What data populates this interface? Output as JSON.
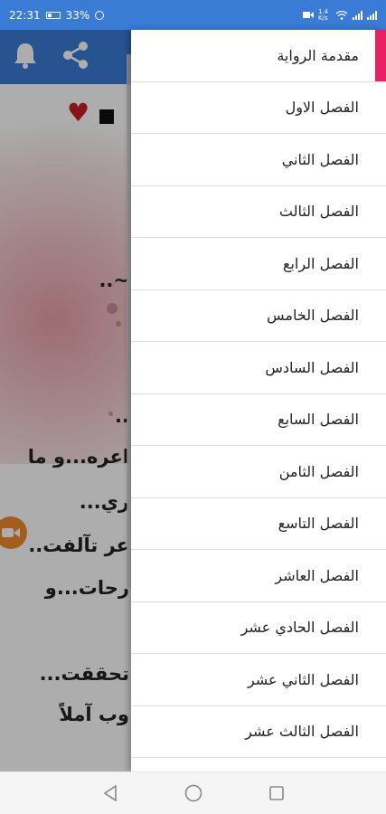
{
  "status_bar": {
    "time": "22:31",
    "battery": "33%",
    "network_speed": "1.4 K/s",
    "icons": [
      "battery-icon",
      "alarm-icon",
      "screen-record-icon",
      "wifi-icon",
      "signal-icon"
    ]
  },
  "toolbar": {
    "icons": [
      "bell-icon",
      "share-icon"
    ],
    "color": "#3a7bd5"
  },
  "story_text_fragments": [
    "~..",
    "..",
    "اعره...و ما",
    "ري...",
    "عر تآلفت..",
    "رحات...و",
    "تحققت...",
    "وب آملاً"
  ],
  "drawer": {
    "items": [
      "مقدمة الرواية",
      "الفصل الاول",
      "الفصل الثاني",
      "الفصل الثالث",
      "الفصل الرابع",
      "الفصل الخامس",
      "الفصل السادس",
      "الفصل السابع",
      "الفصل الثامن",
      "الفصل التاسع",
      "الفصل العاشر",
      "الفصل الحادي عشر",
      "الفصل الثاني عشر",
      "الفصل الثالث عشر"
    ],
    "active_index": 0,
    "accent_color": "#e91e63"
  },
  "nav_bar": {
    "icons": [
      "back-icon",
      "home-icon",
      "recents-icon"
    ]
  }
}
